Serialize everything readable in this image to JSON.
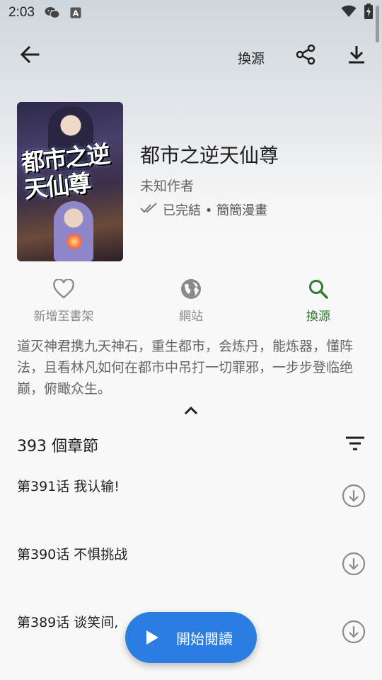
{
  "status_bar": {
    "time": "2:03",
    "icons": [
      "wechat-icon",
      "a-badge-icon",
      "wifi-icon",
      "battery-icon"
    ]
  },
  "app_bar": {
    "back_icon": "arrow-left-icon",
    "source_label": "換源",
    "share_icon": "share-icon",
    "download_icon": "download-icon"
  },
  "manga": {
    "title": "都市之逆天仙尊",
    "author": "未知作者",
    "status": "已完結 • 簡簡漫畫",
    "cover_art_text": "都市之逆天仙尊",
    "description": "道灭神君携九天神石，重生都市，会炼丹，能炼器，懂阵法，且看林凡如何在都市中吊打一切罪邪，一步步登临绝巅，俯瞰众生。"
  },
  "actions": [
    {
      "label": "新增至書架",
      "icon": "heart-outline-icon",
      "active": false
    },
    {
      "label": "網站",
      "icon": "globe-icon",
      "active": false
    },
    {
      "label": "換源",
      "icon": "search-icon",
      "active": true
    }
  ],
  "chapters": {
    "count_label": "393 個章節",
    "items": [
      {
        "name": "第391话 我认输!"
      },
      {
        "name": "第390话 不惧挑战"
      },
      {
        "name": "第389话 谈笑间,"
      }
    ]
  },
  "fab": {
    "label": "開始閱讀",
    "icon": "play-icon"
  },
  "colors": {
    "accent_green": "#2e7d32",
    "fab_blue": "#2a7de1"
  }
}
